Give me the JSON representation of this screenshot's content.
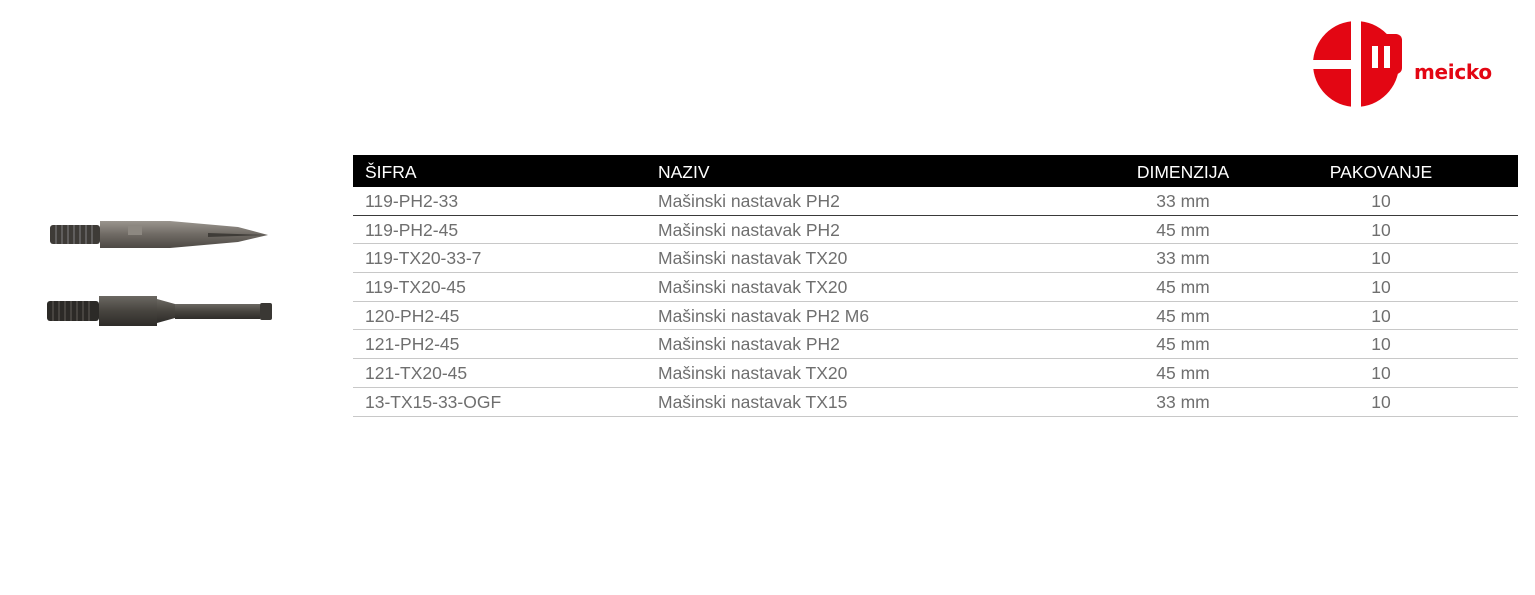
{
  "brand": {
    "name": "meicko",
    "logo_letter": "m",
    "color": "#e30613"
  },
  "images": [
    {
      "icon": "phillips-bit-image"
    },
    {
      "icon": "torx-bit-image"
    }
  ],
  "table": {
    "headers": [
      "ŠIFRA",
      "NAZIV",
      "DIMENZIJA",
      "PAKOVANJE"
    ],
    "rows": [
      [
        "119-PH2-33",
        "Mašinski nastavak PH2",
        "33 mm",
        "10"
      ],
      [
        "119-PH2-45",
        "Mašinski nastavak PH2",
        "45 mm",
        "10"
      ],
      [
        "119-TX20-33-7",
        "Mašinski nastavak TX20",
        "33 mm",
        "10"
      ],
      [
        "119-TX20-45",
        "Mašinski nastavak TX20",
        "45 mm",
        "10"
      ],
      [
        "120-PH2-45",
        "Mašinski nastavak PH2 M6",
        "45 mm",
        "10"
      ],
      [
        "121-PH2-45",
        "Mašinski nastavak PH2",
        "45 mm",
        "10"
      ],
      [
        "121-TX20-45",
        "Mašinski nastavak TX20",
        "45 mm",
        "10"
      ],
      [
        "13-TX15-33-OGF",
        "Mašinski nastavak TX15",
        "33 mm",
        "10"
      ]
    ]
  }
}
